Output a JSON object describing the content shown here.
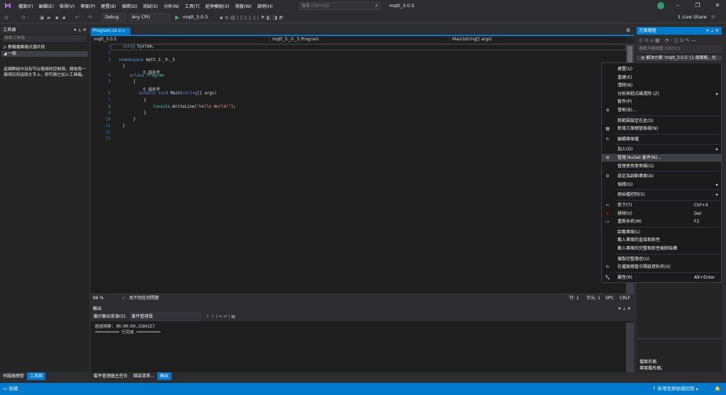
{
  "menu": [
    "檔案(F)",
    "編輯(E)",
    "檢視(V)",
    "專案(P)",
    "建置(B)",
    "偵錯(D)",
    "測試(S)",
    "分析(N)",
    "工具(T)",
    "延伸模組(X)",
    "視窗(W)",
    "說明(H)"
  ],
  "search_placeholder": "搜尋 (Ctrl+Q)",
  "window_title": "mqtt_3.0.5",
  "toolbar": {
    "config": "Debug",
    "platform": "Any CPU",
    "start_label": "mqtt_3.0.5",
    "live_share": "Live Share"
  },
  "toolbox": {
    "header": "工具箱",
    "search": "搜尋工具箱",
    "group1": "▷ 數戰檔案格式選片段",
    "group2": "◢ 一般",
    "message": "這個群組中沒有可以使用的控制項。請拖曳一個項目到這段文字上，即可將它加入工具箱。"
  },
  "editor": {
    "tab": "Program.cs",
    "nav_project": "mqtt_3.0.5",
    "nav_class": "mqtt_3._0._5.Program",
    "nav_member": "Main(string[] args)",
    "line_numbers": [
      "1",
      "2",
      "3",
      "4",
      "5",
      "6",
      "7",
      "8",
      "9",
      "10",
      "11",
      "12",
      "13"
    ],
    "code": {
      "l1": [
        "using",
        " System;"
      ],
      "l3": [
        "namespace",
        " mqtt_3._0._5"
      ],
      "l4": "{",
      "ref1": "0 個參考",
      "l5": [
        "class",
        " Program"
      ],
      "l6": "{",
      "ref2": "0 個參考",
      "l7": [
        "static",
        " ",
        "void",
        " Main(",
        "string",
        "[] args)"
      ],
      "l8": "{",
      "l9": [
        "Console",
        ".WriteLine(",
        "\"Hello World!\"",
        ");"
      ],
      "l10": "}",
      "l11": "}",
      "l12": "}"
    }
  },
  "status_line": {
    "zoom": "98 %",
    "issues": "找不到任何問題",
    "line": "行: 1",
    "char": "字元: 1",
    "spc": "SPC",
    "crlf": "CRLF"
  },
  "output": {
    "header": "輸出",
    "source_label": "顯示輸出來源(S):",
    "source_value": "套件管理員",
    "lines": [
      "經過時間: 00:00:00.1584157",
      "========== 已完成 =========="
    ]
  },
  "bottom_tabs": [
    "套件管理器主控台",
    "錯誤清單...",
    "輸出"
  ],
  "left_tabs": [
    "伺服器總管",
    "工具箱"
  ],
  "statusbar": {
    "ready": "就緒",
    "source_control": "↑ 新增至原始檔控制 ▴"
  },
  "solution_explorer": {
    "header": "方案總管",
    "search": "搜尋方案總管 (Ctrl+;)",
    "item": "解決方案 'mqtt_3.0.5' (1 個專案，共"
  },
  "properties": {
    "line1": "檔案名稱",
    "line2": "專案檔名稱。"
  },
  "context_menu": [
    {
      "icon": "",
      "label": "建置(U)"
    },
    {
      "icon": "",
      "label": "重建(E)"
    },
    {
      "icon": "",
      "label": "清除(N)"
    },
    {
      "icon": "",
      "label": "分析與程式碼清除 (Z)",
      "arrow": "▸"
    },
    {
      "icon": "",
      "label": "套件(P)"
    },
    {
      "icon": "⊕",
      "label": "發佈(B)..."
    },
    {
      "sep": true
    },
    {
      "icon": "",
      "label": "將範圍設定在此(S)"
    },
    {
      "icon": "▦",
      "label": "新增方案總管檢視(N)"
    },
    {
      "sep": true
    },
    {
      "icon": "↻",
      "label": "編輯專案檔"
    },
    {
      "sep": true
    },
    {
      "icon": "",
      "label": "加入(D)",
      "arrow": "▸"
    },
    {
      "icon": "⊞",
      "label": "管理 NuGet 套件(N)...",
      "hover": true
    },
    {
      "icon": "",
      "label": "管理使用者密碼(G)"
    },
    {
      "sep": true
    },
    {
      "icon": "⚙",
      "label": "設定為啟動專案(A)"
    },
    {
      "icon": "",
      "label": "偵錯(G)",
      "arrow": "▸"
    },
    {
      "sep": true
    },
    {
      "icon": "",
      "label": "原始檔控制(S)",
      "arrow": "▸"
    },
    {
      "sep": true
    },
    {
      "icon": "✂",
      "label": "剪下(T)",
      "shortcut": "Ctrl+X"
    },
    {
      "icon": "✕",
      "label": "移除(V)",
      "shortcut": "Del",
      "red": true
    },
    {
      "icon": "▭",
      "label": "重新命名(M)",
      "shortcut": "F2"
    },
    {
      "sep": true
    },
    {
      "icon": "",
      "label": "卸載專案(L)"
    },
    {
      "icon": "",
      "label": "載入專案的直接相依性"
    },
    {
      "icon": "",
      "label": "載入專案的完整相依性樹狀結構"
    },
    {
      "sep": true
    },
    {
      "icon": "",
      "label": "複製完整路徑(U)"
    },
    {
      "icon": "↻",
      "label": "在檔案總管中開啟資料夾(X)"
    },
    {
      "sep": true
    },
    {
      "icon": "🔧",
      "label": "屬性(R)",
      "shortcut": "Alt+Enter"
    }
  ]
}
